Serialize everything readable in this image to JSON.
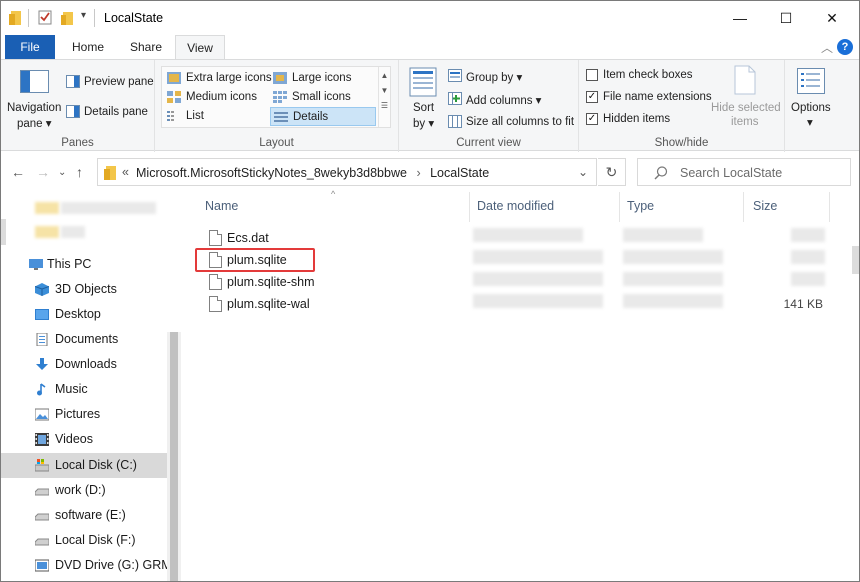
{
  "window": {
    "title": "LocalState",
    "controls": {
      "minimize": "—",
      "maximize": "☐",
      "close": "✕"
    }
  },
  "ribbon_tabs": {
    "file": "File",
    "home": "Home",
    "share": "Share",
    "view": "View"
  },
  "ribbon": {
    "panes": {
      "navigation_pane": "Navigation",
      "navigation_pane_2": "pane ▾",
      "preview_pane": "Preview pane",
      "details_pane": "Details pane",
      "label": "Panes"
    },
    "layout": {
      "extra_large_icons": "Extra large icons",
      "large_icons": "Large icons",
      "medium_icons": "Medium icons",
      "small_icons": "Small icons",
      "list": "List",
      "details": "Details",
      "label": "Layout"
    },
    "current_view": {
      "sort_by": "Sort",
      "sort_by_2": "by ▾",
      "group_by": "Group by ▾",
      "add_columns": "Add columns ▾",
      "size_all_columns": "Size all columns to fit",
      "label": "Current view"
    },
    "show_hide": {
      "item_check_boxes": "Item check boxes",
      "item_check_boxes_checked": false,
      "file_name_extensions": "File name extensions",
      "file_name_extensions_checked": true,
      "hidden_items": "Hidden items",
      "hidden_items_checked": true,
      "hide_selected": "Hide selected",
      "hide_selected_2": "items",
      "label": "Show/hide"
    },
    "options": {
      "label": "Options",
      "arrow": "▾"
    }
  },
  "address": {
    "prefix": "«",
    "path": "Microsoft.MicrosoftStickyNotes_8wekyb3d8bbwe",
    "separator": "›",
    "current": "LocalState",
    "search_placeholder": "Search LocalState"
  },
  "nav_pane": {
    "items": [
      {
        "label": "This PC",
        "icon": "monitor-icon"
      },
      {
        "label": "3D Objects",
        "icon": "cube-icon"
      },
      {
        "label": "Desktop",
        "icon": "desktop-icon"
      },
      {
        "label": "Documents",
        "icon": "documents-icon"
      },
      {
        "label": "Downloads",
        "icon": "download-icon"
      },
      {
        "label": "Music",
        "icon": "music-icon"
      },
      {
        "label": "Pictures",
        "icon": "pictures-icon"
      },
      {
        "label": "Videos",
        "icon": "videos-icon"
      },
      {
        "label": "Local Disk (C:)",
        "icon": "drive-icon",
        "selected": true
      },
      {
        "label": "work (D:)",
        "icon": "drive-icon"
      },
      {
        "label": "software (E:)",
        "icon": "drive-icon"
      },
      {
        "label": "Local Disk (F:)",
        "icon": "drive-icon"
      },
      {
        "label": "DVD Drive (G:) GRM",
        "icon": "dvd-icon"
      }
    ]
  },
  "file_list": {
    "columns": {
      "name": "Name",
      "date_modified": "Date modified",
      "type": "Type",
      "size": "Size"
    },
    "rows": [
      {
        "name": "Ecs.dat",
        "size": ""
      },
      {
        "name": "plum.sqlite",
        "size": "",
        "highlighted": true
      },
      {
        "name": "plum.sqlite-shm",
        "size": ""
      },
      {
        "name": "plum.sqlite-wal",
        "size": "141 KB"
      }
    ]
  },
  "colors": {
    "accent": "#1a5fb4",
    "highlight_box": "#e33a3a",
    "selection": "#cce4f7"
  }
}
